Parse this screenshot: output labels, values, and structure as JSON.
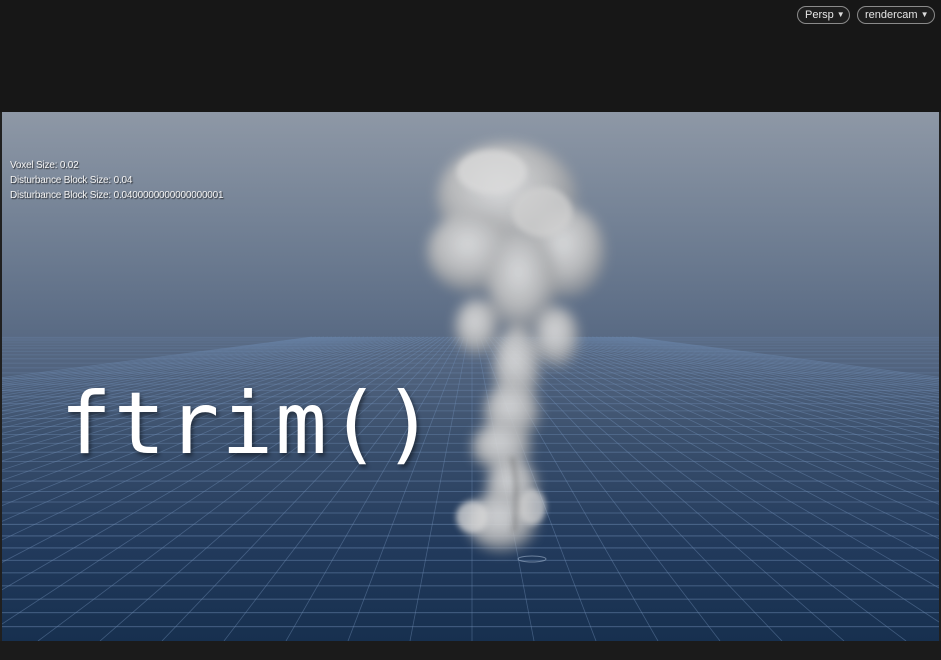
{
  "toolbar": {
    "view_mode_label": "Persp",
    "camera_label": "rendercam",
    "dropdown_icon": "caret-down-icon"
  },
  "viewport": {
    "stats": [
      "Voxel Size: 0.02",
      "Disturbance Block Size: 0.04",
      "Disturbance Block Size: 0.0400000000000000001"
    ],
    "overlay_title": "ftrim()",
    "colors": {
      "sky_top": "#8e98a6",
      "floor_bottom": "#17304f",
      "grid_line": "#6f8db5",
      "smoke": "#c8c8c8"
    }
  }
}
